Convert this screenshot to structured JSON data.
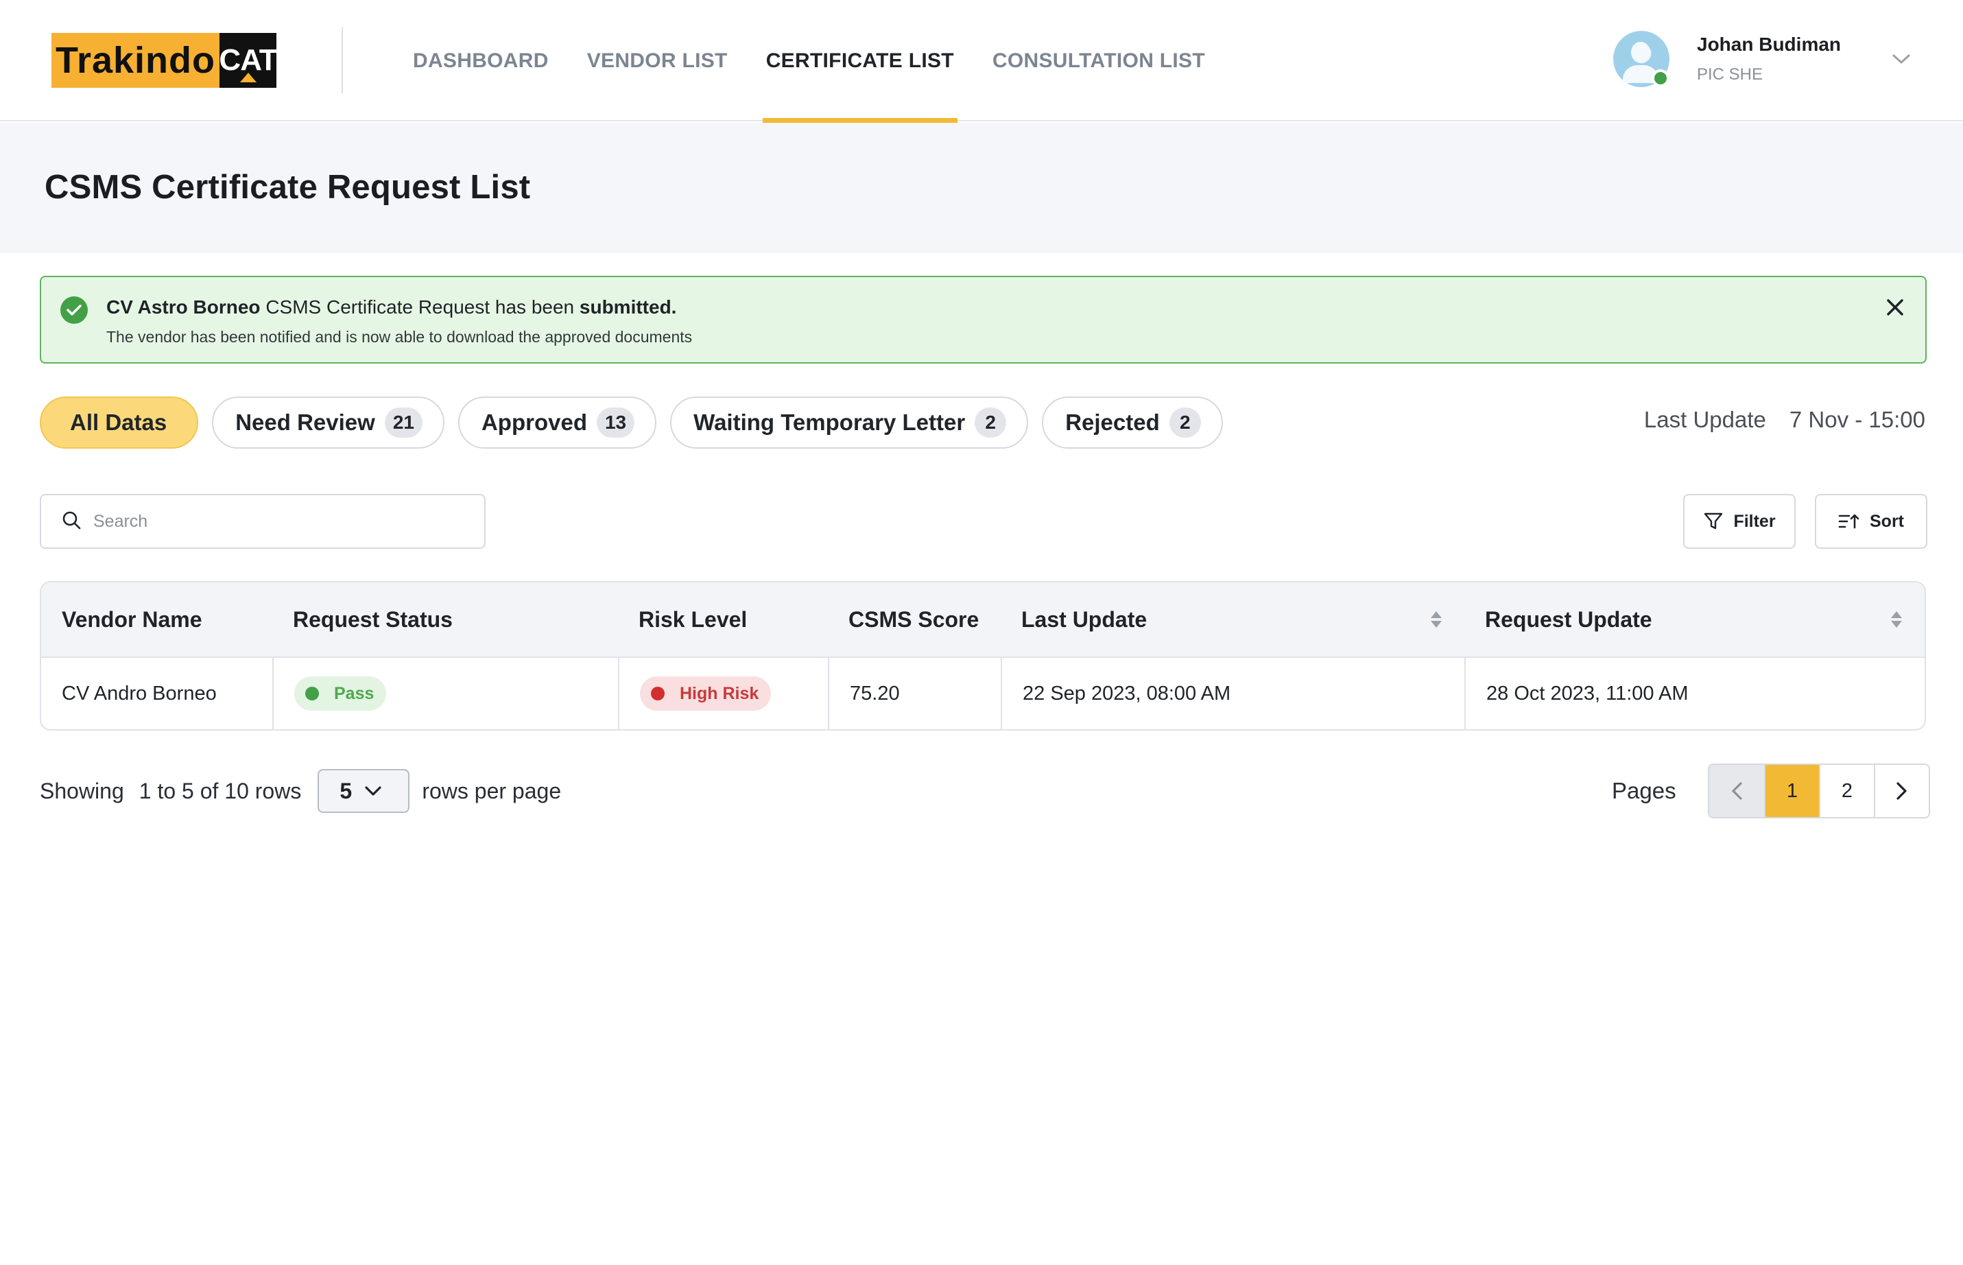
{
  "brand": {
    "name": "Trakindo",
    "cat": "CAT"
  },
  "nav": [
    {
      "label": "DASHBOARD"
    },
    {
      "label": "VENDOR LIST"
    },
    {
      "label": "CERTIFICATE LIST",
      "active": true
    },
    {
      "label": "CONSULTATION LIST"
    }
  ],
  "user": {
    "name": "Johan Budiman",
    "role": "PIC SHE",
    "status": "online"
  },
  "page": {
    "title": "CSMS Certificate Request List"
  },
  "alert": {
    "vendor": "CV Astro Borneo",
    "middle": " CSMS Certificate Request has been ",
    "status": "submitted.",
    "message": "The vendor has been notified and is now able to download the approved documents"
  },
  "tabs": [
    {
      "label": "All Datas",
      "count": null,
      "active": true
    },
    {
      "label": "Need Review",
      "count": "21"
    },
    {
      "label": "Approved",
      "count": "13"
    },
    {
      "label": "Waiting Temporary Letter",
      "count": "2"
    },
    {
      "label": "Rejected",
      "count": "2"
    }
  ],
  "last_update": {
    "label": "Last Update",
    "value": "7 Nov - 15:00"
  },
  "search": {
    "placeholder": "Search",
    "value": ""
  },
  "toolbar": {
    "filter_label": "Filter",
    "sort_label": "Sort"
  },
  "table": {
    "columns": [
      "Vendor Name",
      "Request Status",
      "Risk Level",
      "CSMS Score",
      "Last Update",
      "Request Update"
    ],
    "rows": [
      {
        "vendor_name": "CV Andro Borneo",
        "request_status": "Pass",
        "risk_level": "High Risk",
        "csms_score": "75.20",
        "last_update": "22 Sep 2023, 08:00 AM",
        "request_update": "28 Oct 2023, 11:00 AM"
      }
    ]
  },
  "pagination": {
    "showing_label": "Showing",
    "range": "1 to 5 of 10 rows",
    "rows_per_page": "5",
    "rows_per_page_label": "rows per page",
    "pages_label": "Pages",
    "pages": [
      "1",
      "2"
    ],
    "current_page": "1"
  },
  "colors": {
    "accent": "#f2b934",
    "success": "#43a047",
    "danger": "#d32f2f"
  }
}
